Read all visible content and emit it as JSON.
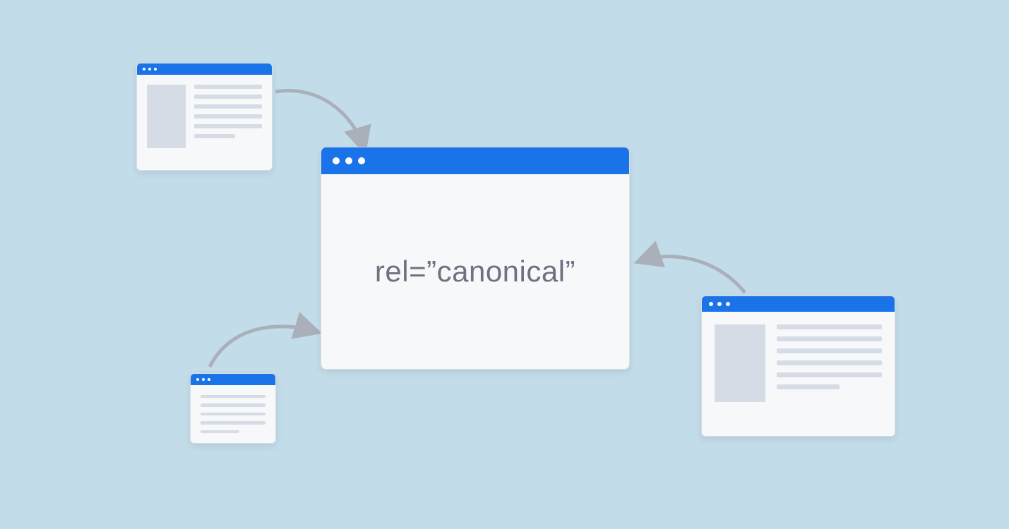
{
  "diagram": {
    "central_label": "rel=”canonical”",
    "concept": "canonical URL tag — multiple duplicate pages pointing to one canonical page",
    "colors": {
      "background": "#c3dcea",
      "accent": "#1a73e8",
      "window_bg": "#f7f8f9",
      "placeholder": "#d5dce6",
      "text": "#6b7280",
      "arrow": "#a9b0ba"
    },
    "windows": {
      "central": {
        "role": "canonical-target",
        "content_type": "code-label"
      },
      "duplicates": [
        {
          "position": "top-left",
          "content_type": "article-with-thumbnail"
        },
        {
          "position": "bottom-left",
          "content_type": "text-lines"
        },
        {
          "position": "right",
          "content_type": "article-with-thumbnail"
        }
      ]
    },
    "arrows": [
      {
        "from": "top-left",
        "to": "central"
      },
      {
        "from": "bottom-left",
        "to": "central"
      },
      {
        "from": "right",
        "to": "central"
      }
    ]
  }
}
